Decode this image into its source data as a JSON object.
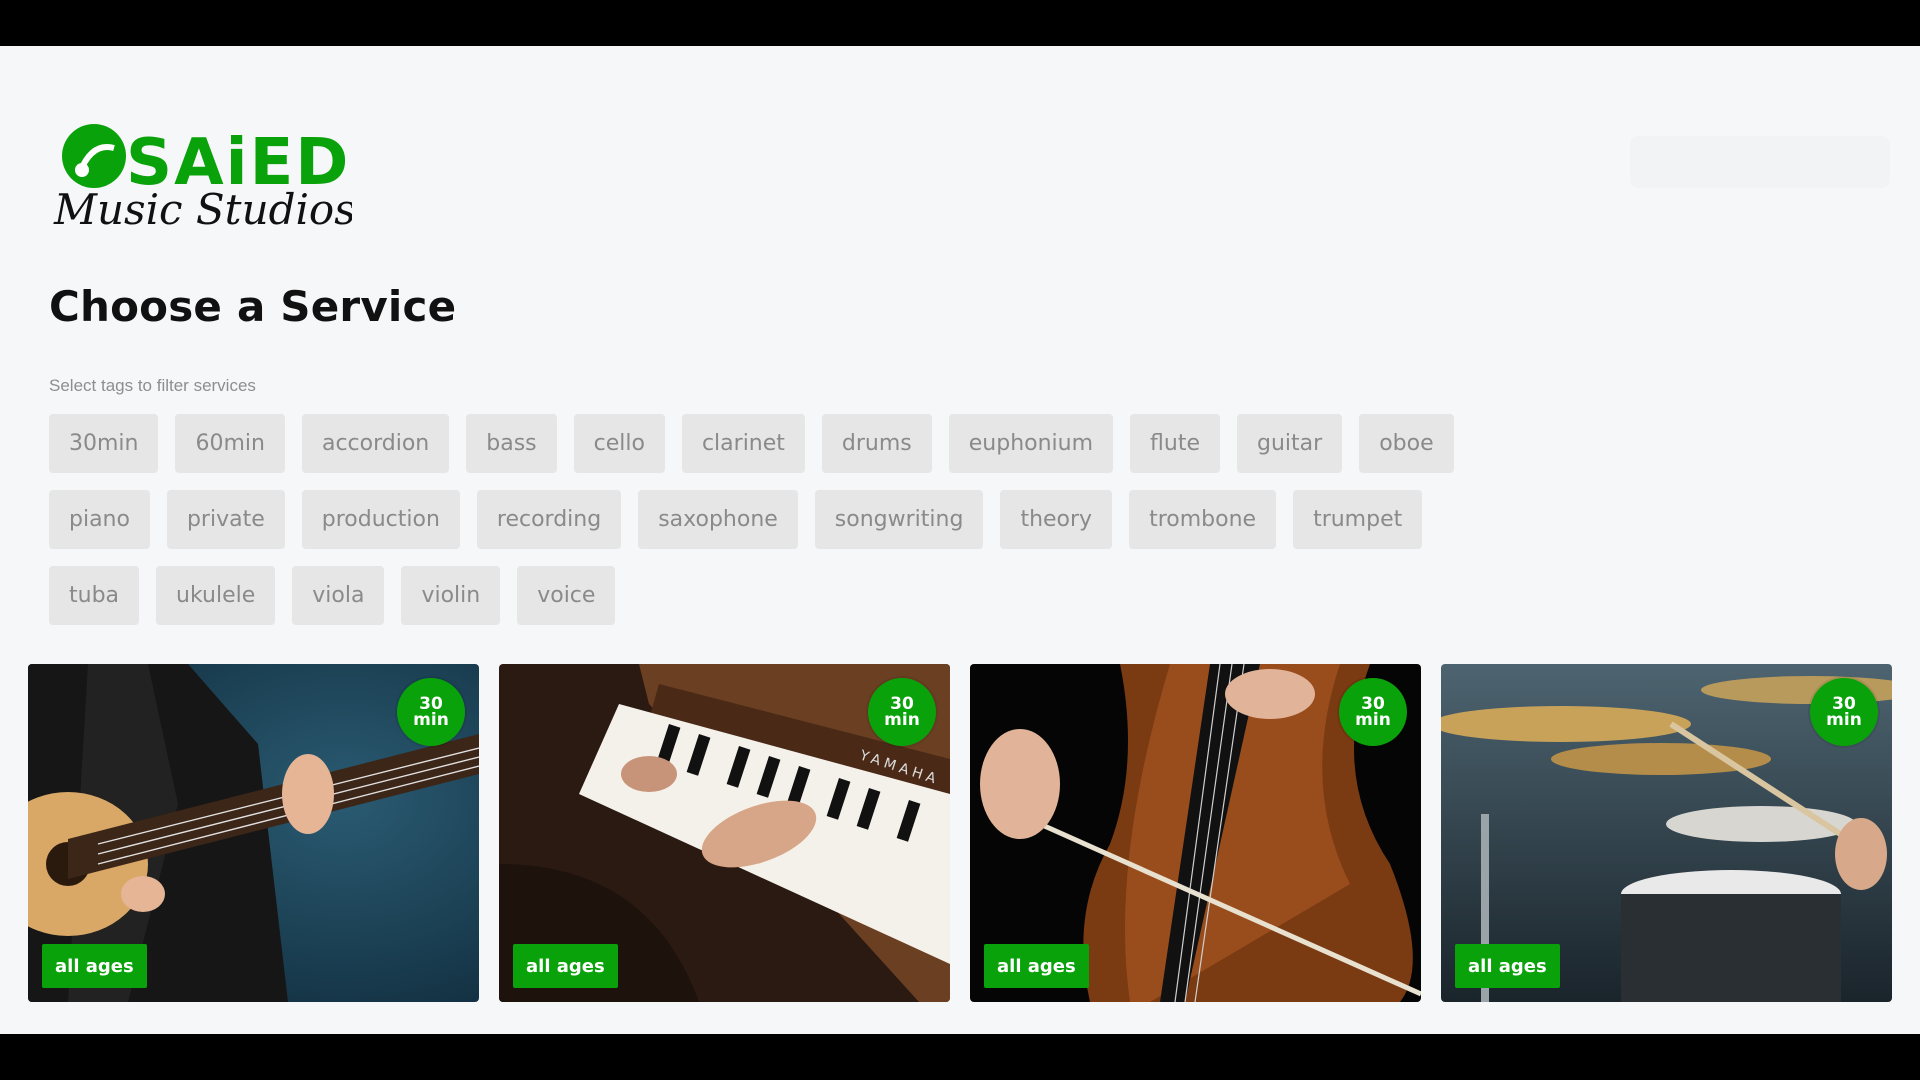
{
  "brand": {
    "logo_text": "SAiED",
    "logo_subtext": "Music Studios",
    "color": "#0aa20a"
  },
  "page": {
    "title": "Choose a Service",
    "filter_hint": "Select tags to filter services"
  },
  "tags": {
    "row1": [
      "30min",
      "60min",
      "accordion",
      "bass",
      "cello",
      "clarinet",
      "drums",
      "euphonium",
      "flute",
      "guitar",
      "oboe"
    ],
    "row2": [
      "piano",
      "private",
      "production",
      "recording",
      "saxophone",
      "songwriting",
      "theory",
      "trombone",
      "trumpet"
    ],
    "row3": [
      "tuba",
      "ukulele",
      "viola",
      "violin",
      "voice"
    ]
  },
  "services": [
    {
      "image": "guitar-photo",
      "duration_num": "30",
      "duration_unit": "min",
      "ages": "all ages"
    },
    {
      "image": "piano-photo",
      "duration_num": "30",
      "duration_unit": "min",
      "ages": "all ages"
    },
    {
      "image": "cello-photo",
      "duration_num": "30",
      "duration_unit": "min",
      "ages": "all ages"
    },
    {
      "image": "drums-photo",
      "duration_num": "30",
      "duration_unit": "min",
      "ages": "all ages"
    }
  ],
  "photo_text": {
    "piano_brand": "YAMAHA"
  }
}
